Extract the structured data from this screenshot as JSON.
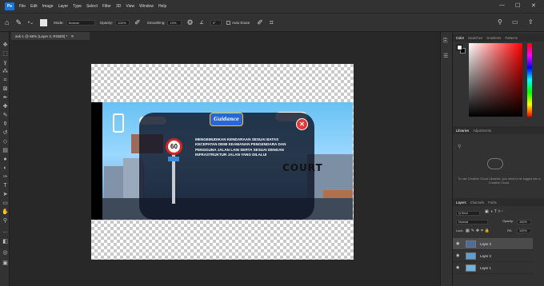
{
  "menubar": {
    "logo": "Ps",
    "items": [
      "File",
      "Edit",
      "Image",
      "Layer",
      "Type",
      "Select",
      "Filter",
      "3D",
      "View",
      "Window",
      "Help"
    ],
    "window_controls": [
      "—",
      "☐",
      "✕"
    ]
  },
  "options": {
    "mode_label": "Mode:",
    "mode_value": "Normal",
    "opacity_label": "Opacity:",
    "opacity_value": "100%",
    "smoothing_label": "Smoothing:",
    "smoothing_value": "10%",
    "angle_value": "0°",
    "auto_erase_label": "Auto Erase"
  },
  "document": {
    "tab_title": "ask-1 @ 66% (Layer 3, RGB/8) *"
  },
  "scene": {
    "guidance_label": "Guidance",
    "close_glyph": "✕",
    "speed_limit": "60",
    "court_text": "COURT",
    "dialog_text": "MENGEMUDIKAN KENDARAAN SESUAI BATAS KECEPATAN DEMI KEAMANAN PENGENDARA DAN PENGGUNA JALAN LAIN SERTA SESUAI DENGAN INFRASTRUKTUR JALAN YANG DILALUI"
  },
  "color_panel": {
    "tabs": [
      "Color",
      "Swatches",
      "Gradients",
      "Patterns"
    ]
  },
  "libraries_panel": {
    "tabs": [
      "Libraries",
      "Adjustments"
    ],
    "message": "To use Creative Cloud Libraries, you need to be logged into a Creative Cloud."
  },
  "layers_panel": {
    "tabs": [
      "Layers",
      "Channels",
      "Paths"
    ],
    "kind_filter": "Q Kind",
    "blend_mode": "Normal",
    "opacity_label": "Opacity:",
    "opacity_value": "100%",
    "lock_label": "Lock:",
    "fill_label": "Fill:",
    "fill_value": "100%",
    "layers": [
      {
        "name": "Layer 3",
        "selected": true
      },
      {
        "name": "Layer 2",
        "selected": false
      },
      {
        "name": "Layer 1",
        "selected": false
      }
    ]
  },
  "colors": {
    "accent": "#1473e6",
    "panel_bg": "#323232",
    "workspace_bg": "#282828"
  }
}
